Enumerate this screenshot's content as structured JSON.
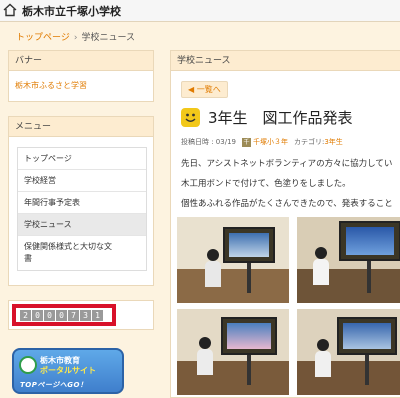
{
  "header": {
    "site_title": "栃木市立千塚小学校"
  },
  "breadcrumb": {
    "home": "トップページ",
    "current": "学校ニュース"
  },
  "banner_panel": {
    "title": "バナー",
    "link": "栃木市ふるさと学習"
  },
  "menu_panel": {
    "title": "メニュー",
    "items": [
      {
        "label": "トップページ"
      },
      {
        "label": "学校経営"
      },
      {
        "label": "年間行事予定表"
      },
      {
        "label": "学校ニュース"
      },
      {
        "label_line1": "保健関係様式と大切な文",
        "label_line2": "書"
      }
    ]
  },
  "counter": {
    "digits": [
      "2",
      "0",
      "0",
      "0",
      "7",
      "3",
      "1"
    ]
  },
  "portal": {
    "line1": "栃木市教育",
    "line2": "ポータルサイト",
    "line3": "TOPページへGO！"
  },
  "news": {
    "panel_title": "学校ニュース",
    "back_label": "◀ 一覧へ",
    "title": "3年生　図工作品発表",
    "meta": {
      "posted_label": "投稿日時 : 03/19",
      "user_chip": "千",
      "user": "千塚小３年",
      "category_label": "カテゴリ:",
      "category": "3年生"
    },
    "body": [
      "先日、アシストネットボランティアの方々に協力してい",
      "木工用ボンドで付けて、色塗りをしました。",
      "個性あふれる作品がたくさんできたので、発表すること"
    ]
  },
  "colors": {
    "accent": "#e07b00",
    "counter_border": "#d8112a",
    "panel_head": "#fdecd0"
  }
}
